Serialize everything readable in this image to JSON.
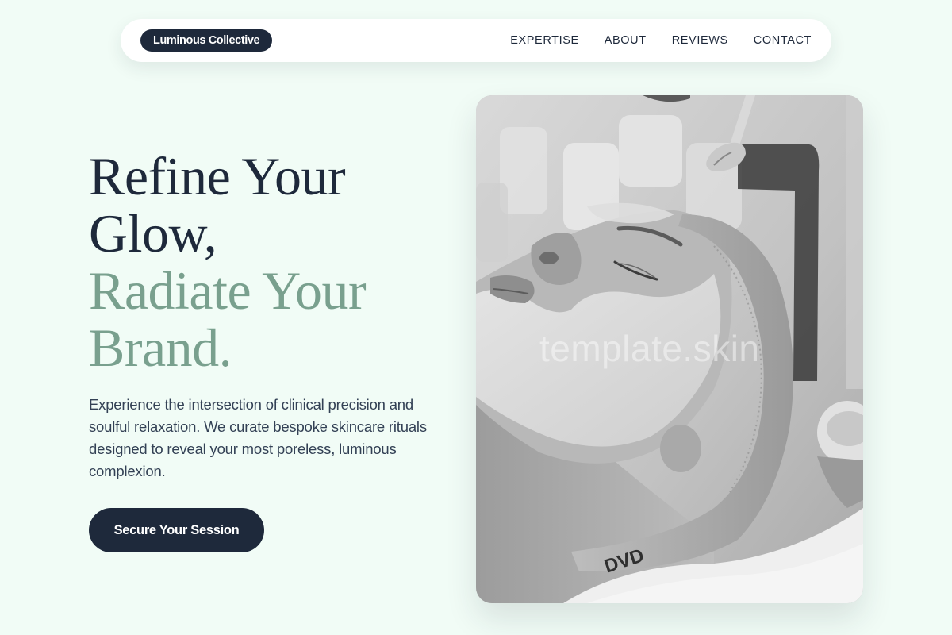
{
  "nav": {
    "brand": "Luminous Collective",
    "links": [
      "EXPERTISE",
      "ABOUT",
      "REVIEWS",
      "CONTACT"
    ]
  },
  "hero": {
    "title_lines": [
      "Refine Your",
      "Glow,"
    ],
    "title_accent_lines": [
      "Radiate Your",
      "Brand."
    ],
    "description": "Experience the intersection of clinical precision and soulful relaxation. We curate bespoke skincare rituals designed to reveal your most poreless, luminous complexion.",
    "cta_label": "Secure Your Session"
  },
  "image": {
    "alt": "Woman receiving a facial mask treatment with a brush",
    "watermark": "template.skin",
    "headband_text": "DVD"
  },
  "colors": {
    "background": "#f1fcf6",
    "navy": "#1e293b",
    "sage_accent": "#79a08e",
    "body_text": "#334155"
  }
}
